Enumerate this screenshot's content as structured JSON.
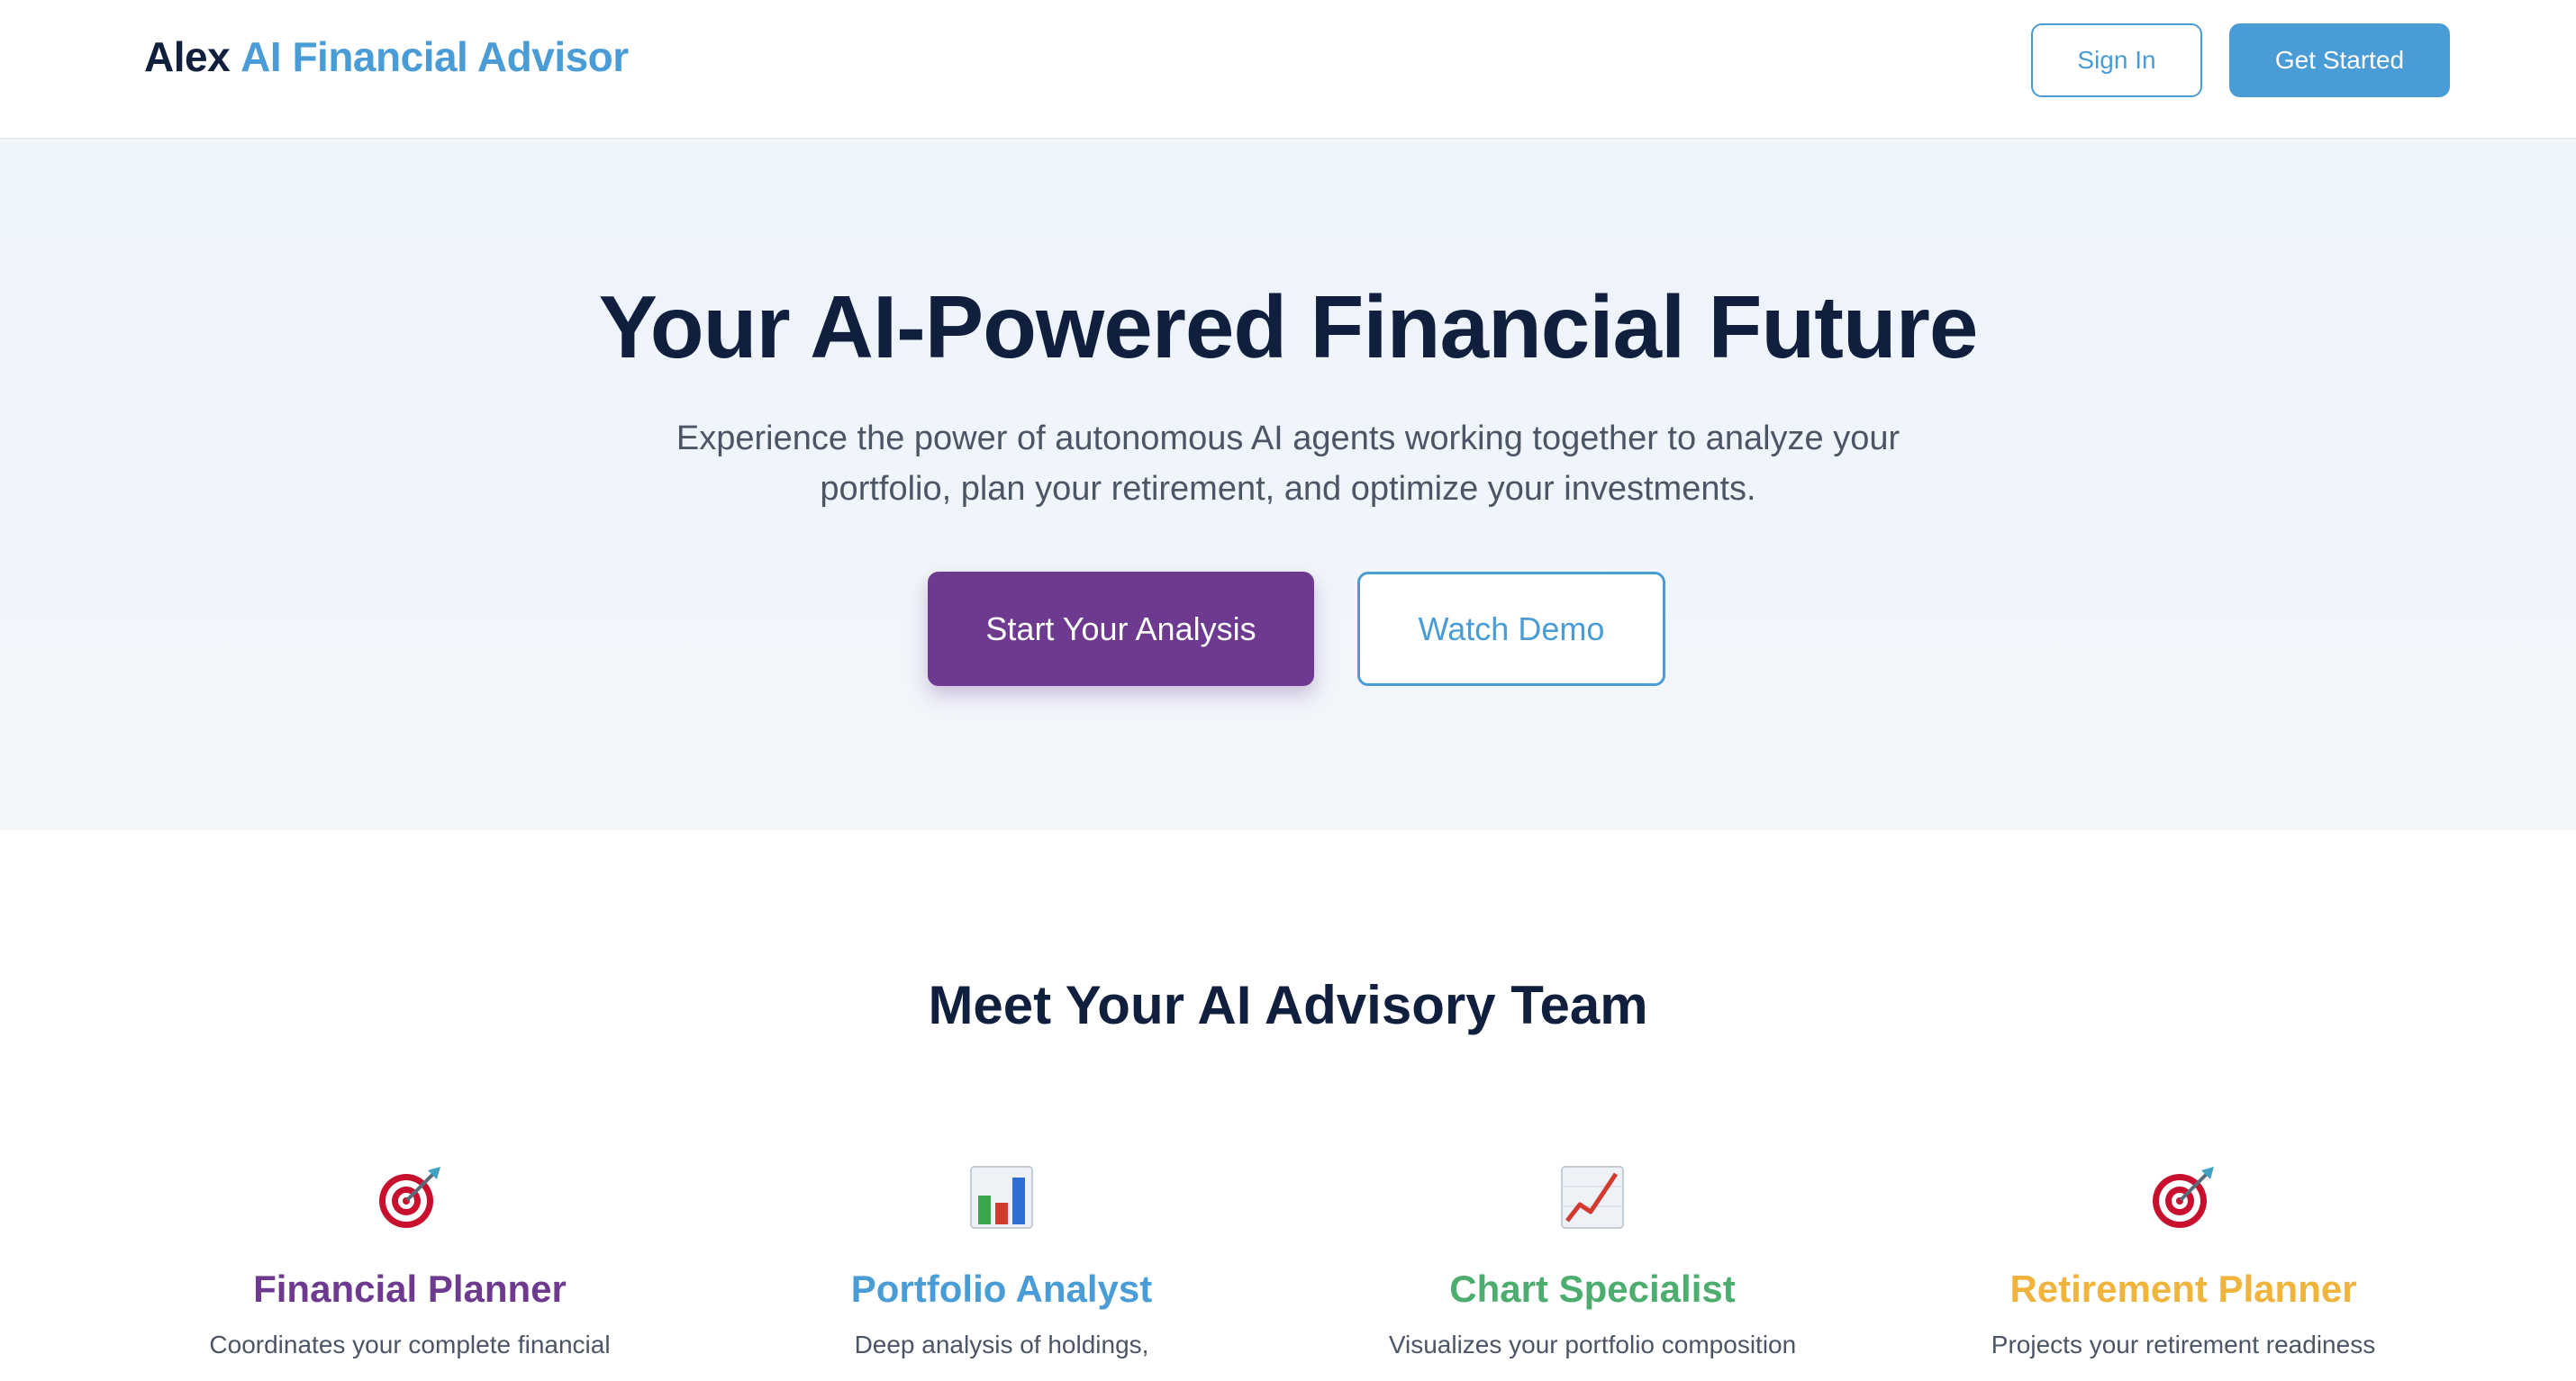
{
  "header": {
    "brand_primary": "Alex",
    "brand_accent": "AI Financial Advisor",
    "sign_in_label": "Sign In",
    "get_started_label": "Get Started"
  },
  "hero": {
    "title": "Your AI-Powered Financial Future",
    "subtitle": "Experience the power of autonomous AI agents working together to analyze your portfolio, plan your retirement, and optimize your investments.",
    "primary_cta": "Start Your Analysis",
    "secondary_cta": "Watch Demo"
  },
  "team": {
    "heading": "Meet Your AI Advisory Team",
    "agents": [
      {
        "icon": "target-icon",
        "title": "Financial Planner",
        "description": "Coordinates your complete financial",
        "color": "#6e3a8f"
      },
      {
        "icon": "bar-chart-icon",
        "title": "Portfolio Analyst",
        "description": "Deep analysis of holdings,",
        "color": "#4a9cd6"
      },
      {
        "icon": "trend-chart-icon",
        "title": "Chart Specialist",
        "description": "Visualizes your portfolio composition",
        "color": "#4cad6e"
      },
      {
        "icon": "target-icon",
        "title": "Retirement Planner",
        "description": "Projects your retirement readiness",
        "color": "#f0b43c"
      }
    ]
  },
  "colors": {
    "navy": "#0f1f3d",
    "accent_blue": "#4a9cd6",
    "purple": "#6e3a8f",
    "hero_bg": "#eef4fc"
  }
}
